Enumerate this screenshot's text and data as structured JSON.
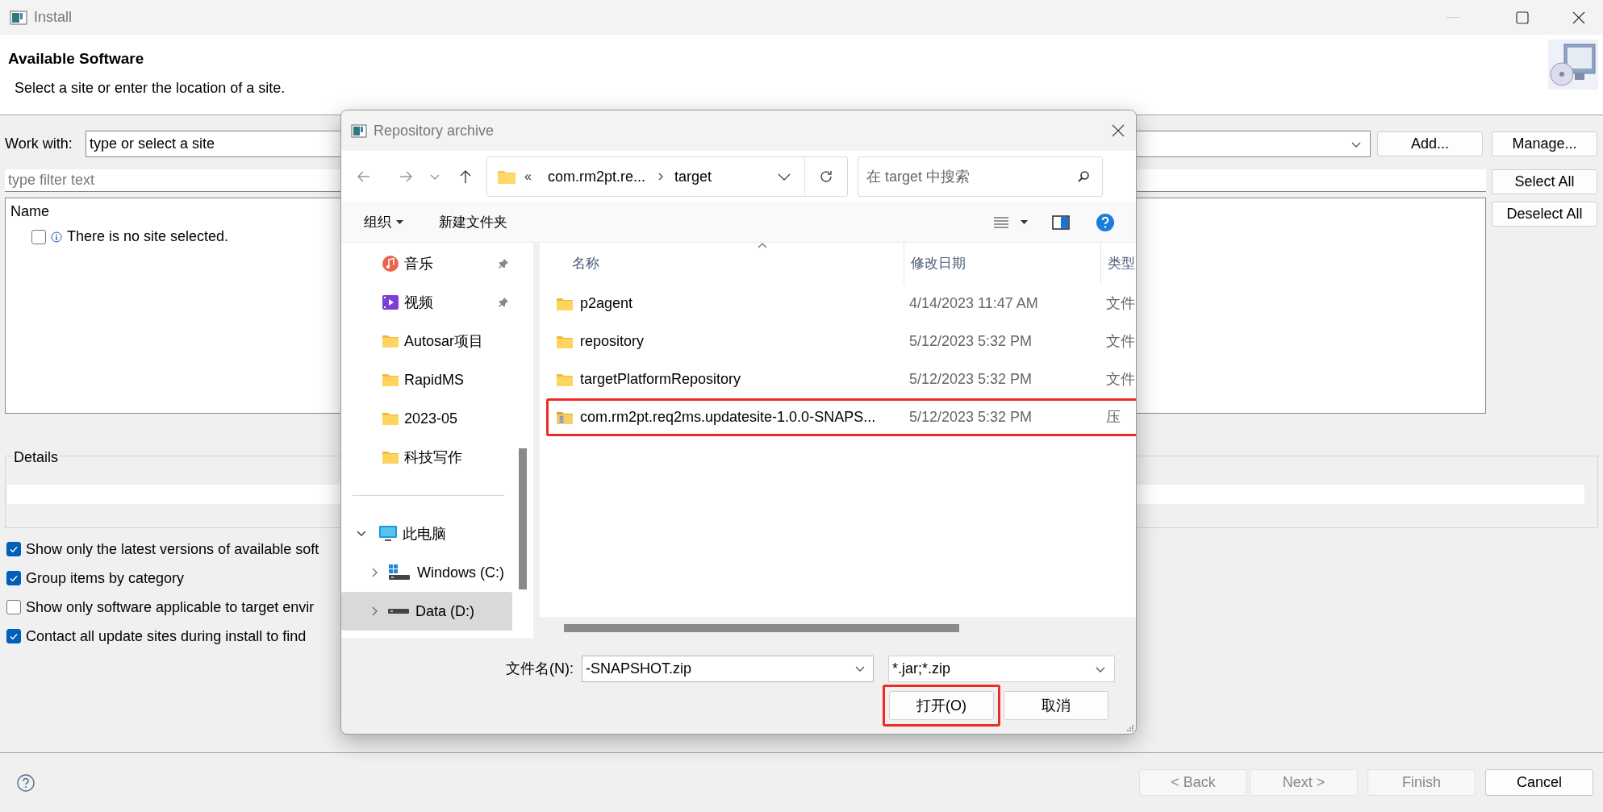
{
  "window": {
    "title": "Install"
  },
  "header": {
    "title": "Available Software",
    "subtitle": "Select a site or enter the location of a site."
  },
  "work_with": {
    "label": "Work with:",
    "value": "type or select a site"
  },
  "site_buttons": [
    "Add...",
    "Manage..."
  ],
  "filter": {
    "placeholder": "type filter text"
  },
  "select_buttons": [
    "Select All",
    "Deselect All"
  ],
  "tree": {
    "header": "Name",
    "items": [
      {
        "label": "There is no site selected.",
        "checked": false
      }
    ]
  },
  "details": {
    "title": "Details"
  },
  "options": [
    {
      "label": "Show only the latest versions of available soft",
      "checked": true
    },
    {
      "label": "Group items by category",
      "checked": true
    },
    {
      "label": "Show only software applicable to target envir",
      "checked": false
    },
    {
      "label": "Contact all update sites during install to find",
      "checked": true
    }
  ],
  "footer_buttons": [
    {
      "label": "< Back",
      "disabled": true
    },
    {
      "label": "Next >",
      "disabled": true
    },
    {
      "label": "Finish",
      "disabled": true
    },
    {
      "label": "Cancel",
      "disabled": false
    }
  ],
  "dialog": {
    "title": "Repository archive",
    "path_overflow": "«",
    "path": [
      "com.rm2pt.re...",
      "target"
    ],
    "search": {
      "placeholder": "在 target 中搜索"
    },
    "toolbar": [
      {
        "label": "组织",
        "dropdown": true
      },
      {
        "label": "新建文件夹",
        "dropdown": false
      }
    ],
    "quick_access": [
      {
        "label": "音乐",
        "kind": "music",
        "pinned": true
      },
      {
        "label": "视频",
        "kind": "video",
        "pinned": true
      },
      {
        "label": "Autosar项目",
        "kind": "folder",
        "pinned": false
      },
      {
        "label": "RapidMS",
        "kind": "folder",
        "pinned": false
      },
      {
        "label": "2023-05",
        "kind": "folder",
        "pinned": false
      },
      {
        "label": "科技写作",
        "kind": "folder",
        "pinned": false
      }
    ],
    "this_pc": {
      "label": "此电脑",
      "expanded": true,
      "children": [
        {
          "label": "Windows (C:)",
          "kind": "system",
          "expanded": false,
          "selected": false
        },
        {
          "label": "Data (D:)",
          "kind": "drive",
          "expanded": false,
          "selected": true
        }
      ]
    },
    "columns": [
      "名称",
      "修改日期",
      "类型"
    ],
    "files": [
      {
        "name": "p2agent",
        "date": "4/14/2023 11:47 AM",
        "type": "文件",
        "kind": "folder",
        "highlighted": false
      },
      {
        "name": "repository",
        "date": "5/12/2023 5:32 PM",
        "type": "文件",
        "kind": "folder",
        "highlighted": false
      },
      {
        "name": "targetPlatformRepository",
        "date": "5/12/2023 5:32 PM",
        "type": "文件",
        "kind": "folder",
        "highlighted": false
      },
      {
        "name": "com.rm2pt.req2ms.updatesite-1.0.0-SNAPS...",
        "date": "5/12/2023 5:32 PM",
        "type": "压",
        "kind": "zip",
        "highlighted": true
      }
    ],
    "filename": {
      "label": "文件名(N):",
      "value": "-SNAPSHOT.zip"
    },
    "filetype": {
      "value": "*.jar;*.zip"
    },
    "buttons": [
      {
        "label": "打开(O)",
        "highlighted": true
      },
      {
        "label": "取消",
        "highlighted": false
      }
    ]
  }
}
